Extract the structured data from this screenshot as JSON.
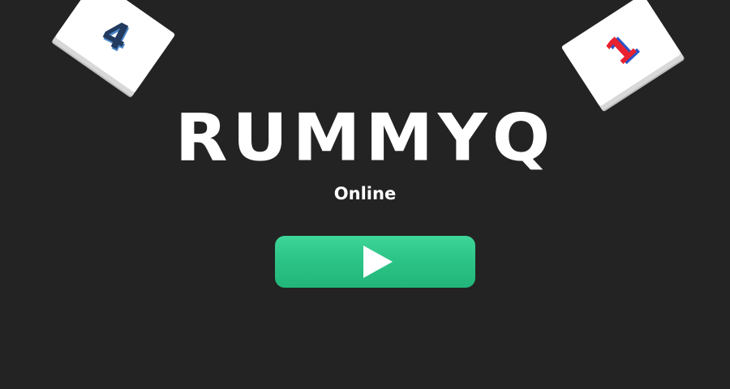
{
  "game": {
    "title": "RUMMYQ",
    "subtitle": "Online"
  },
  "tiles": [
    {
      "number": "4",
      "color": "#223a5e"
    },
    {
      "number": "1",
      "color": "#e8222e"
    }
  ],
  "play_button": {
    "icon": "play-icon",
    "color": "#2dc487"
  },
  "colors": {
    "background": "#232323",
    "text": "#ffffff",
    "accent": "#2dc487"
  }
}
